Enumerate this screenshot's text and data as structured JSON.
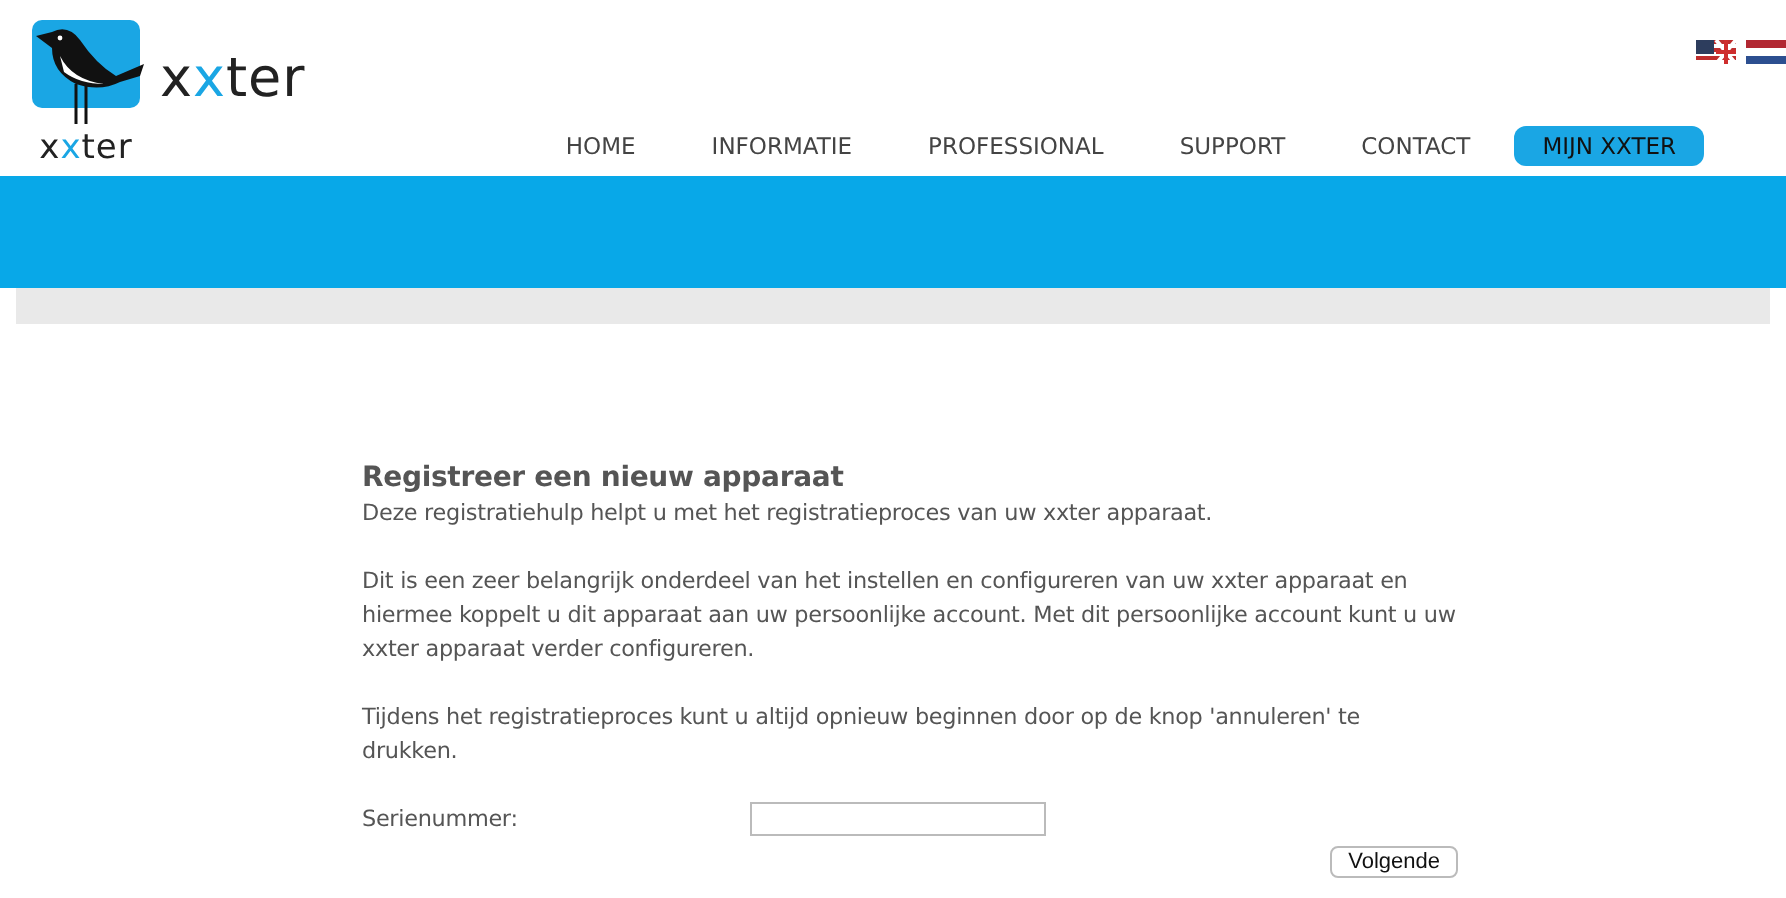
{
  "logo": {
    "small_wordmark": [
      {
        "text": "x",
        "accent": false
      },
      {
        "text": "x",
        "accent": true
      },
      {
        "text": "ter",
        "accent": false
      }
    ],
    "large_wordmark": [
      {
        "text": "x",
        "accent": false
      },
      {
        "text": "x",
        "accent": true
      },
      {
        "text": "ter",
        "accent": false
      }
    ]
  },
  "languages": [
    {
      "kind": "english",
      "selected": false
    },
    {
      "kind": "dutch",
      "selected": false
    }
  ],
  "nav": [
    {
      "label": "HOME",
      "selected": false
    },
    {
      "label": "INFORMATIE",
      "selected": false
    },
    {
      "label": "PROFESSIONAL",
      "selected": false
    },
    {
      "label": "SUPPORT",
      "selected": false
    },
    {
      "label": "CONTACT",
      "selected": false
    },
    {
      "label": "MIJN XXTER",
      "selected": true
    }
  ],
  "content": {
    "title": "Registreer een nieuw apparaat",
    "paragraphs": [
      "Deze registratiehulp helpt u met het registratieproces van uw xxter apparaat.",
      "Dit is een zeer belangrijk onderdeel van het instellen en configureren van uw xxter apparaat en hiermee koppelt u dit apparaat aan uw persoonlijke account. Met dit persoonlijke account kunt u uw xxter apparaat verder configureren.",
      "Tijdens het registratieproces kunt u altijd opnieuw beginnen door op de knop 'annuleren' te drukken."
    ],
    "field_label": "Serienummer:",
    "button": "Volgende"
  }
}
